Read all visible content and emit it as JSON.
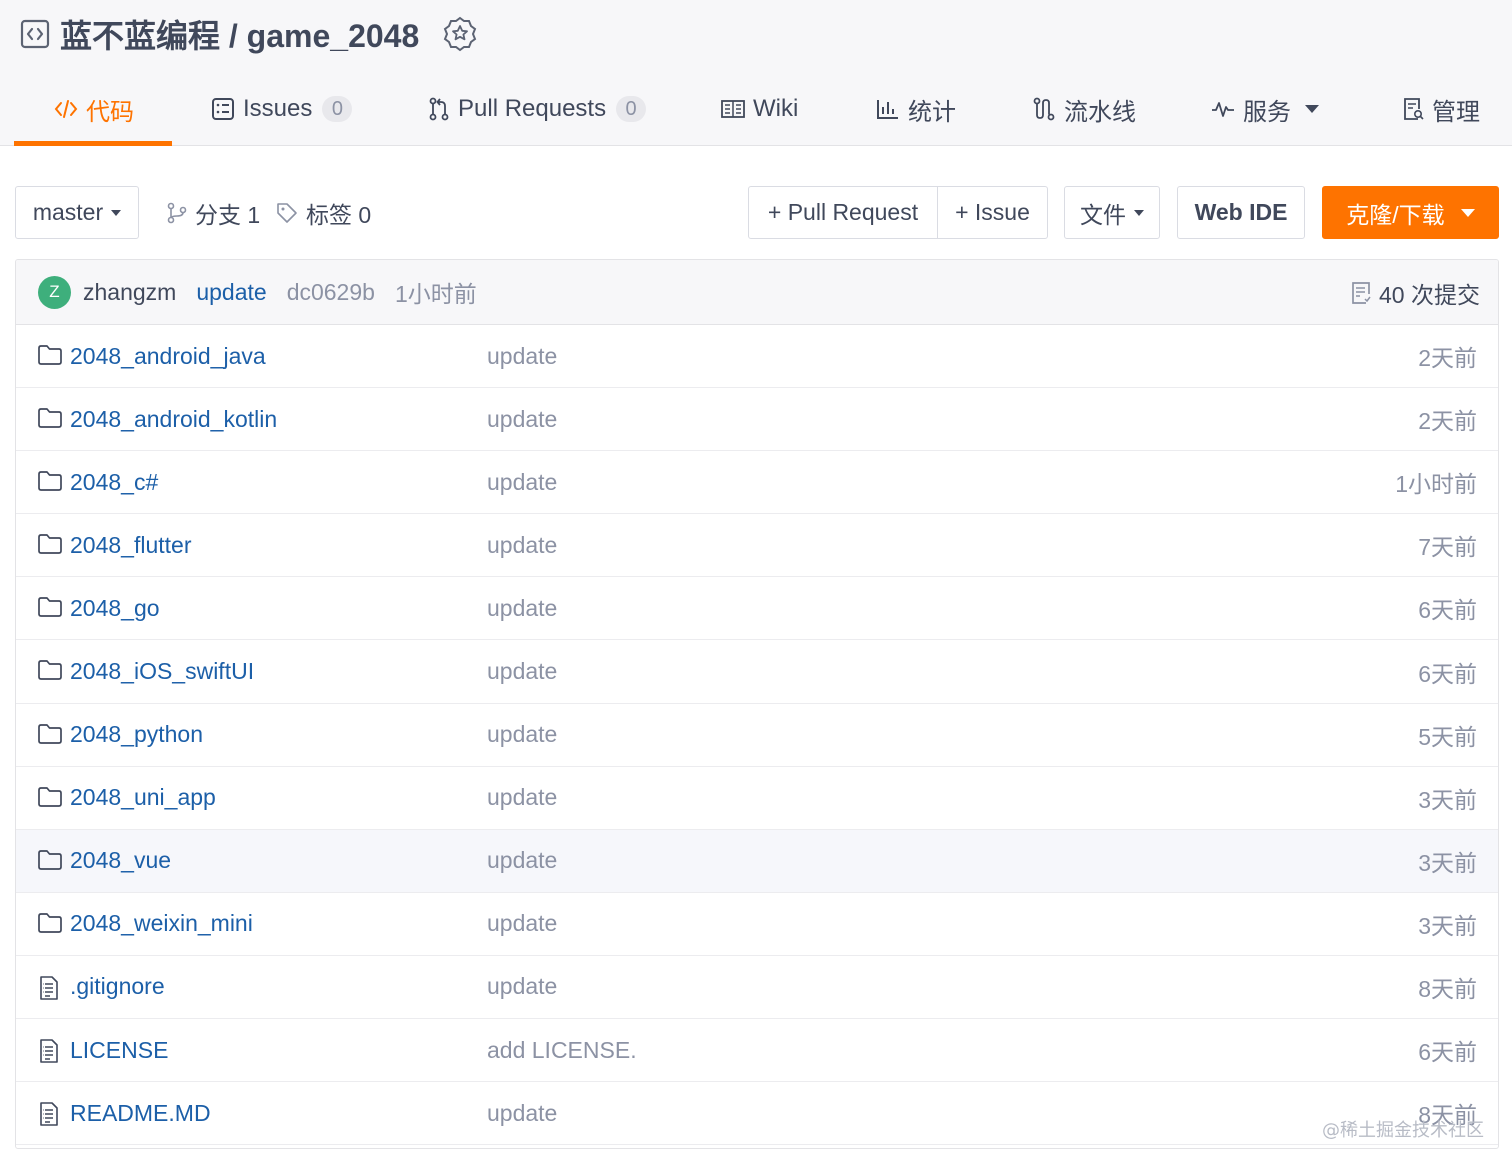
{
  "header": {
    "repo_path": "蓝不蓝编程 / game_2048"
  },
  "tabs": [
    {
      "label": "代码",
      "icon": "code-icon",
      "active": true
    },
    {
      "label": "Issues",
      "icon": "issues-icon",
      "count": "0"
    },
    {
      "label": "Pull Requests",
      "icon": "pull-request-icon",
      "count": "0"
    },
    {
      "label": "Wiki",
      "icon": "wiki-icon"
    },
    {
      "label": "统计",
      "icon": "stats-icon"
    },
    {
      "label": "流水线",
      "icon": "pipeline-icon"
    },
    {
      "label": "服务",
      "icon": "service-icon",
      "dropdown": true
    },
    {
      "label": "管理",
      "icon": "manage-icon"
    }
  ],
  "toolbar": {
    "branch": "master",
    "branches": "分支 1",
    "tags": "标签 0",
    "new_pr": "+ Pull Request",
    "new_issue": "+ Issue",
    "file_menu": "文件",
    "web_ide": "Web IDE",
    "clone": "克隆/下载"
  },
  "commit": {
    "avatar_letter": "Z",
    "author": "zhangzm",
    "message": "update",
    "hash": "dc0629b",
    "time": "1小时前",
    "count": "40 次提交"
  },
  "files": [
    {
      "name": "2048_android_java",
      "type": "folder",
      "message": "update",
      "time": "2天前"
    },
    {
      "name": "2048_android_kotlin",
      "type": "folder",
      "message": "update",
      "time": "2天前"
    },
    {
      "name": "2048_c#",
      "type": "folder",
      "message": "update",
      "time": "1小时前"
    },
    {
      "name": "2048_flutter",
      "type": "folder",
      "message": "update",
      "time": "7天前"
    },
    {
      "name": "2048_go",
      "type": "folder",
      "message": "update",
      "time": "6天前"
    },
    {
      "name": "2048_iOS_swiftUI",
      "type": "folder",
      "message": "update",
      "time": "6天前"
    },
    {
      "name": "2048_python",
      "type": "folder",
      "message": "update",
      "time": "5天前"
    },
    {
      "name": "2048_uni_app",
      "type": "folder",
      "message": "update",
      "time": "3天前"
    },
    {
      "name": "2048_vue",
      "type": "folder",
      "message": "update",
      "time": "3天前"
    },
    {
      "name": "2048_weixin_mini",
      "type": "folder",
      "message": "update",
      "time": "3天前"
    },
    {
      "name": ".gitignore",
      "type": "file",
      "message": "update",
      "time": "8天前"
    },
    {
      "name": "LICENSE",
      "type": "file",
      "message": "add LICENSE.",
      "time": "6天前"
    },
    {
      "name": "README.MD",
      "type": "file",
      "message": "update",
      "time": "8天前"
    }
  ],
  "watermark": "@稀土掘金技术社区",
  "colors": {
    "accent": "#fe7300",
    "link": "#1c5fa8",
    "muted": "#8c92a4"
  }
}
